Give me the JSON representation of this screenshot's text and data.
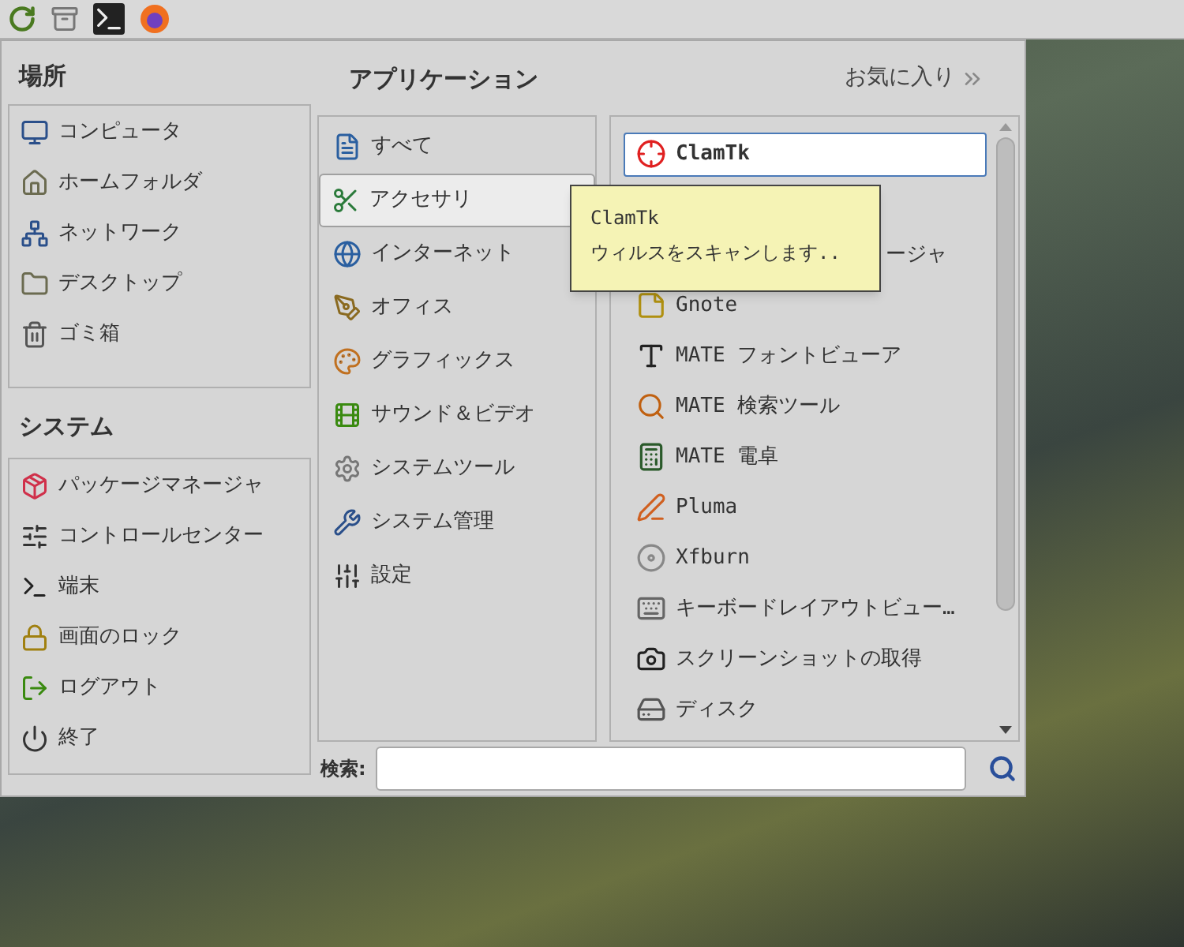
{
  "places": {
    "title": "場所",
    "items": [
      {
        "label": "コンピュータ"
      },
      {
        "label": "ホームフォルダ"
      },
      {
        "label": "ネットワーク"
      },
      {
        "label": "デスクトップ"
      },
      {
        "label": "ゴミ箱"
      }
    ]
  },
  "system": {
    "title": "システム",
    "items": [
      {
        "label": "パッケージマネージャ"
      },
      {
        "label": "コントロールセンター"
      },
      {
        "label": "端末"
      },
      {
        "label": "画面のロック"
      },
      {
        "label": "ログアウト"
      },
      {
        "label": "終了"
      }
    ]
  },
  "applications": {
    "title": "アプリケーション",
    "favorites": "お気に入り",
    "categories": [
      {
        "label": "すべて",
        "selected": false
      },
      {
        "label": "アクセサリ",
        "selected": true
      },
      {
        "label": "インターネット",
        "selected": false
      },
      {
        "label": "オフィス",
        "selected": false
      },
      {
        "label": "グラフィックス",
        "selected": false
      },
      {
        "label": "サウンド＆ビデオ",
        "selected": false
      },
      {
        "label": "システムツール",
        "selected": false
      },
      {
        "label": "システム管理",
        "selected": false
      },
      {
        "label": "設定",
        "selected": false
      }
    ],
    "apps": [
      {
        "label": "ClamTk",
        "selected": true,
        "covered": false
      },
      {
        "label": "ージャ",
        "selected": false,
        "covered": true
      },
      {
        "label": "Gnote",
        "selected": false,
        "covered": false
      },
      {
        "label": "MATE フォントビューア",
        "selected": false,
        "covered": false
      },
      {
        "label": "MATE 検索ツール",
        "selected": false,
        "covered": false
      },
      {
        "label": "MATE 電卓",
        "selected": false,
        "covered": false
      },
      {
        "label": "Pluma",
        "selected": false,
        "covered": false
      },
      {
        "label": "Xfburn",
        "selected": false,
        "covered": false
      },
      {
        "label": "キーボードレイアウトビュー…",
        "selected": false,
        "covered": false
      },
      {
        "label": "スクリーンショットの取得",
        "selected": false,
        "covered": false
      },
      {
        "label": "ディスク",
        "selected": false,
        "covered": false
      }
    ]
  },
  "search": {
    "label": "検索:"
  },
  "tooltip": {
    "title": "ClamTk",
    "description": "ウィルスをスキャンします.."
  }
}
